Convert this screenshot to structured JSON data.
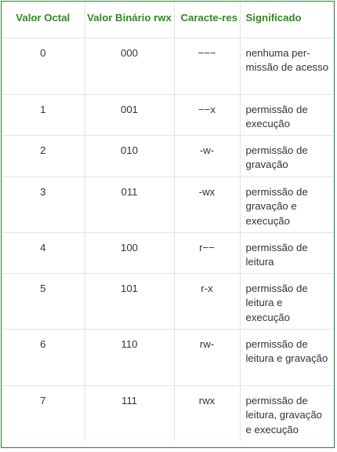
{
  "table": {
    "headers": [
      "Valor Octal",
      "Valor Binário rwx",
      "Caracte-res",
      "Significado"
    ],
    "rows": [
      {
        "octal": "0",
        "binary": "000",
        "chars": "−−−",
        "meaning": "nenhuma per-missão de acesso"
      },
      {
        "octal": "1",
        "binary": "001",
        "chars": "−−x",
        "meaning": "permissão de execução"
      },
      {
        "octal": "2",
        "binary": "010",
        "chars": "-w-",
        "meaning": "permissão de gravação"
      },
      {
        "octal": "3",
        "binary": "011",
        "chars": "-wx",
        "meaning": "permissão de gravação e execução"
      },
      {
        "octal": "4",
        "binary": "100",
        "chars": "r−−",
        "meaning": "permissão de leitura"
      },
      {
        "octal": "5",
        "binary": "101",
        "chars": "r-x",
        "meaning": "permissão de leitura e execução"
      },
      {
        "octal": "6",
        "binary": "110",
        "chars": "rw-",
        "meaning": "permissão de leitura e gravação"
      },
      {
        "octal": "7",
        "binary": "111",
        "chars": "rwx",
        "meaning": "permissão de leitura, gravação e execução"
      }
    ]
  },
  "colors": {
    "header_text": "#2e8b1f",
    "border": "#2e7d32",
    "body_text": "#333333"
  }
}
